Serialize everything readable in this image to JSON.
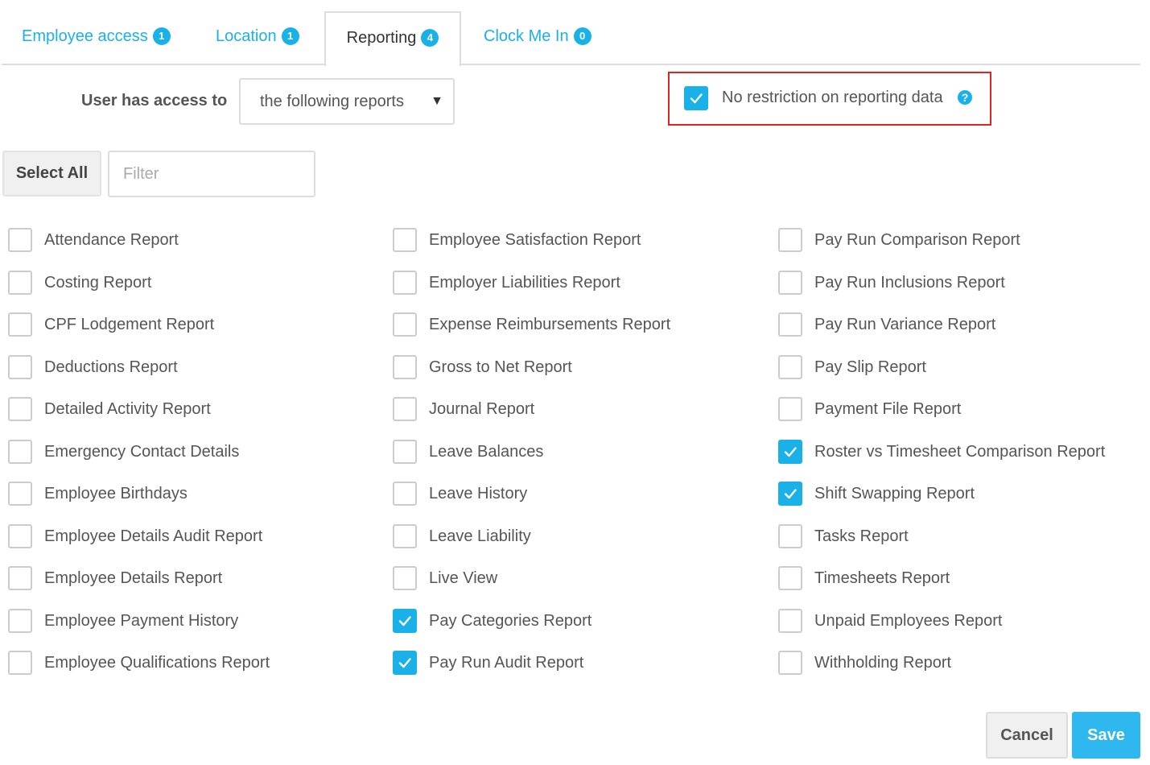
{
  "tabs": [
    {
      "label": "Employee access",
      "count": "1"
    },
    {
      "label": "Location",
      "count": "1"
    },
    {
      "label": "Reporting",
      "count": "4"
    },
    {
      "label": "Clock Me In",
      "count": "0"
    }
  ],
  "access": {
    "label": "User has access to",
    "selected": "the following reports"
  },
  "restriction": {
    "label": "No restriction on reporting data",
    "checked": true
  },
  "toolbar": {
    "select_all": "Select All",
    "filter_placeholder": "Filter"
  },
  "reports": {
    "col1": [
      {
        "label": "Attendance Report",
        "checked": false
      },
      {
        "label": "Costing Report",
        "checked": false
      },
      {
        "label": "CPF Lodgement Report",
        "checked": false
      },
      {
        "label": "Deductions Report",
        "checked": false
      },
      {
        "label": "Detailed Activity Report",
        "checked": false
      },
      {
        "label": "Emergency Contact Details",
        "checked": false
      },
      {
        "label": "Employee Birthdays",
        "checked": false
      },
      {
        "label": "Employee Details Audit Report",
        "checked": false
      },
      {
        "label": "Employee Details Report",
        "checked": false
      },
      {
        "label": "Employee Payment History",
        "checked": false
      },
      {
        "label": "Employee Qualifications Report",
        "checked": false
      }
    ],
    "col2": [
      {
        "label": "Employee Satisfaction Report",
        "checked": false
      },
      {
        "label": "Employer Liabilities Report",
        "checked": false
      },
      {
        "label": "Expense Reimbursements Report",
        "checked": false
      },
      {
        "label": "Gross to Net Report",
        "checked": false
      },
      {
        "label": "Journal Report",
        "checked": false
      },
      {
        "label": "Leave Balances",
        "checked": false
      },
      {
        "label": "Leave History",
        "checked": false
      },
      {
        "label": "Leave Liability",
        "checked": false
      },
      {
        "label": "Live View",
        "checked": false
      },
      {
        "label": "Pay Categories Report",
        "checked": true
      },
      {
        "label": "Pay Run Audit Report",
        "checked": true
      }
    ],
    "col3": [
      {
        "label": "Pay Run Comparison Report",
        "checked": false
      },
      {
        "label": "Pay Run Inclusions Report",
        "checked": false
      },
      {
        "label": "Pay Run Variance Report",
        "checked": false
      },
      {
        "label": "Pay Slip Report",
        "checked": false
      },
      {
        "label": "Payment File Report",
        "checked": false
      },
      {
        "label": "Roster vs Timesheet Comparison Report",
        "checked": true
      },
      {
        "label": "Shift Swapping Report",
        "checked": true
      },
      {
        "label": "Tasks Report",
        "checked": false
      },
      {
        "label": "Timesheets Report",
        "checked": false
      },
      {
        "label": "Unpaid Employees Report",
        "checked": false
      },
      {
        "label": "Withholding Report",
        "checked": false
      }
    ]
  },
  "footer": {
    "cancel": "Cancel",
    "save": "Save"
  },
  "colors": {
    "accent": "#1ab0e8",
    "save_button": "#2fb7ef",
    "highlight_border": "#e02424"
  }
}
